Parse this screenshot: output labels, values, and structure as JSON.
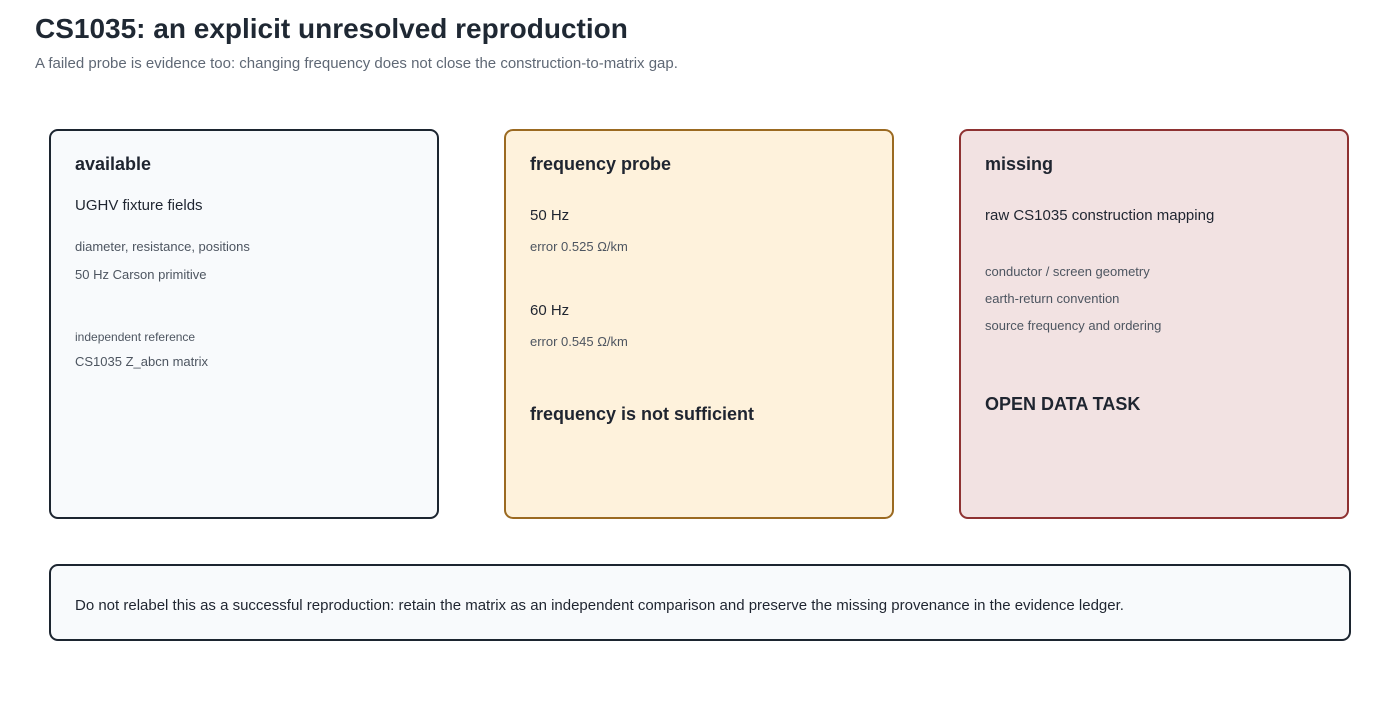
{
  "header": {
    "title": "CS1035: an explicit unresolved reproduction",
    "subtitle": "A failed probe is evidence too: changing frequency does not close the construction-to-matrix gap."
  },
  "cards": {
    "available": {
      "heading": "available",
      "primary": "UGHV fixture fields",
      "details": [
        "diameter, resistance, positions",
        "50 Hz Carson primitive"
      ],
      "reference_label": "independent reference",
      "reference_value": "CS1035 Z_abcn matrix"
    },
    "probe": {
      "heading": "frequency probe",
      "probes": [
        {
          "frequency": "50 Hz",
          "error": "error 0.525 Ω/km"
        },
        {
          "frequency": "60 Hz",
          "error": "error 0.545 Ω/km"
        }
      ],
      "conclusion": "frequency is not sufficient"
    },
    "missing": {
      "heading": "missing",
      "primary": "raw CS1035 construction mapping",
      "details": [
        "conductor / screen geometry",
        "earth-return convention",
        "source frequency and ordering"
      ],
      "status": "OPEN DATA TASK"
    }
  },
  "note": {
    "text": "Do not relabel this as a successful reproduction: retain the matrix as an independent comparison and preserve the missing provenance in the evidence ledger."
  },
  "colors": {
    "available_fill": "#f8fafc",
    "available_border": "#1c2530",
    "probe_fill": "#fef2dc",
    "probe_border": "#9b6a21",
    "missing_fill": "#f2e2e2",
    "missing_border": "#8e3232"
  }
}
